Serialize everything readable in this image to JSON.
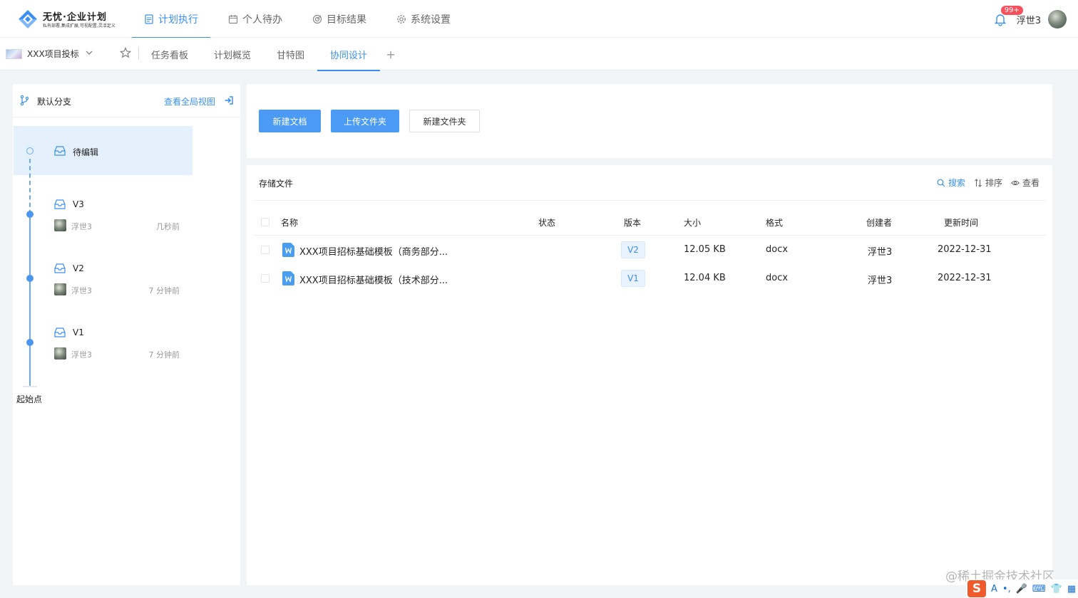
{
  "app": {
    "title": "无忧·企业计划",
    "subtitle": "私有部署,集成扩展,可视配置,灵活定义"
  },
  "main_nav": [
    {
      "label": "计划执行",
      "active": true,
      "icon": "document-icon"
    },
    {
      "label": "个人待办",
      "active": false,
      "icon": "calendar-icon"
    },
    {
      "label": "目标结果",
      "active": false,
      "icon": "target-icon"
    },
    {
      "label": "系统设置",
      "active": false,
      "icon": "gear-icon"
    }
  ],
  "user": {
    "notification_badge": "99+",
    "name": "浮世3"
  },
  "project": {
    "name": "XXX项目投标"
  },
  "tabs": [
    {
      "label": "任务看板",
      "active": false
    },
    {
      "label": "计划概览",
      "active": false
    },
    {
      "label": "甘特图",
      "active": false
    },
    {
      "label": "协同设计",
      "active": true
    }
  ],
  "tab_add_label": "+",
  "branch": {
    "name": "默认分支",
    "global_view_label": "查看全局视图",
    "draft_label": "待编辑",
    "origin_label": "起始点",
    "versions": [
      {
        "label": "V3",
        "user": "浮世3",
        "time": "几秒前"
      },
      {
        "label": "V2",
        "user": "浮世3",
        "time": "7 分钟前"
      },
      {
        "label": "V1",
        "user": "浮世3",
        "time": "7 分钟前"
      }
    ]
  },
  "toolbar": {
    "new_doc": "新建文档",
    "upload_folder": "上传文件夹",
    "new_folder": "新建文件夹"
  },
  "files": {
    "title": "存储文件",
    "actions": {
      "search": "搜索",
      "sort": "排序",
      "view": "查看"
    },
    "columns": [
      "名称",
      "状态",
      "版本",
      "大小",
      "格式",
      "创建者",
      "更新时间"
    ],
    "rows": [
      {
        "name": "XXX项目招标基础模板（商务部分...",
        "status": "",
        "version": "V2",
        "size": "12.05 KB",
        "format": "docx",
        "creator": "浮世3",
        "updated": "2022-12-31"
      },
      {
        "name": "XXX项目招标基础模板（技术部分...",
        "status": "",
        "version": "V1",
        "size": "12.04 KB",
        "format": "docx",
        "creator": "浮世3",
        "updated": "2022-12-31"
      }
    ]
  },
  "watermark": "@稀土掘金技术社区",
  "ime": {
    "logo": "S",
    "items": [
      "A",
      "•,",
      "🎤",
      "⌨",
      "👕",
      "▦"
    ]
  },
  "colors": {
    "accent": "#3b8ff0",
    "primary_button": "#4b9bf5",
    "badge": "#f5505c",
    "selected_bg": "#e5f0fd"
  }
}
